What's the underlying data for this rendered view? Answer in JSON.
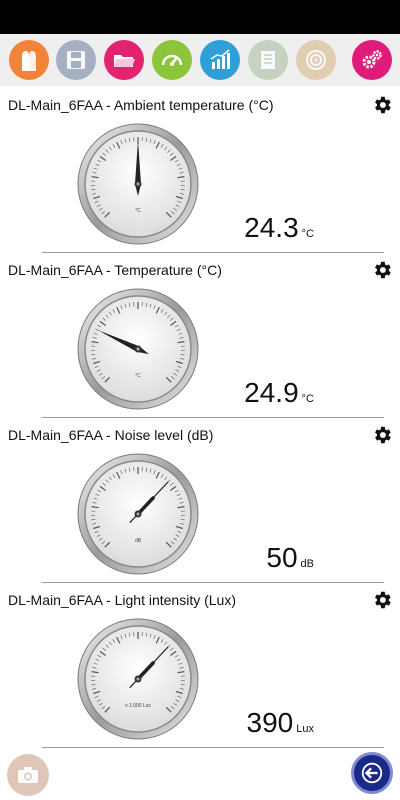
{
  "toolbar": {
    "buttons": [
      {
        "name": "profile-button",
        "icon": "two-figures-icon",
        "color": "#f2843a",
        "active": true
      },
      {
        "name": "save-button",
        "icon": "floppy-disk-icon",
        "color": "#6a7fa0",
        "active": false
      },
      {
        "name": "open-folder-button",
        "icon": "folder-icon",
        "color": "#e2246f",
        "active": true
      },
      {
        "name": "gauge-view-button",
        "icon": "speedometer-icon",
        "color": "#8cc43c",
        "active": true
      },
      {
        "name": "chart-view-button",
        "icon": "bar-chart-icon",
        "color": "#2f9fd8",
        "active": true
      },
      {
        "name": "table-view-button",
        "icon": "spreadsheet-icon",
        "color": "#a9bfa0",
        "active": false
      },
      {
        "name": "sensor-target-button",
        "icon": "target-icon",
        "color": "#d8b88a",
        "active": false
      },
      {
        "name": "settings-button",
        "icon": "gears-icon",
        "color": "#e01c7a",
        "active": true
      }
    ]
  },
  "sensors": [
    {
      "title": "DL-Main_6FAA - Ambient temperature (°C)",
      "value": "24.3",
      "unit": "°C",
      "dial_label": "°C",
      "needle_fraction": 0.5,
      "needle_style": "pointer"
    },
    {
      "title": "DL-Main_6FAA - Temperature (°C)",
      "value": "24.9",
      "unit": "°C",
      "dial_label": "°C",
      "needle_fraction": 0.26,
      "needle_style": "pointer"
    },
    {
      "title": "DL-Main_6FAA - Noise level (dB)",
      "value": "50",
      "unit": "dB",
      "dial_label": "dB",
      "needle_fraction": 0.66,
      "needle_style": "line"
    },
    {
      "title": "DL-Main_6FAA - Light intensity (Lux)",
      "value": "390",
      "unit": "Lux",
      "dial_label": "x 1.000 Lux",
      "needle_fraction": 0.66,
      "needle_style": "line"
    }
  ],
  "bottom": {
    "camera_icon": "camera-icon",
    "camera_color": "#d8b8a8",
    "back_icon": "back-arrow-icon",
    "back_color": "#1b2a8a"
  }
}
